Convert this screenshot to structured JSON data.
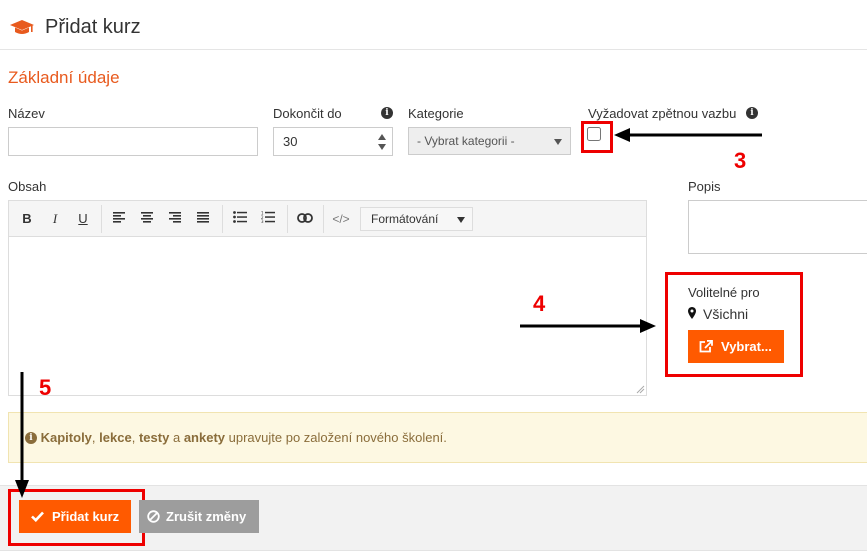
{
  "header": {
    "title": "Přidat kurz",
    "icon": "graduation-cap-icon"
  },
  "section_title": "Základní údaje",
  "fields": {
    "name_label": "Název",
    "name_value": "",
    "finish_label": "Dokončit do",
    "finish_value": "30",
    "category_label": "Kategorie",
    "category_value": "- Vybrat kategorii -",
    "feedback_label": "Vyžadovat zpětnou vazbu",
    "feedback_checked": false,
    "content_label": "Obsah",
    "description_label": "Popis",
    "description_value": ""
  },
  "editor_toolbar": {
    "bold": "B",
    "italic": "I",
    "underline": "U",
    "format_label": "Formátování"
  },
  "optional": {
    "label": "Volitelné pro",
    "value": "Všichni",
    "button": "Vybrat..."
  },
  "notice": {
    "w1": "Kapitoly",
    "s1": ",",
    "w2": "lekce",
    "s2": ",",
    "w3": "testy",
    "s3": "a",
    "w4": "ankety",
    "rest": "upravujte po založení nového školení."
  },
  "footer": {
    "add_button": "Přidat kurz",
    "cancel_button": "Zrušit změny"
  },
  "annotations": {
    "n3": "3",
    "n4": "4",
    "n5": "5"
  },
  "colors": {
    "accent": "#ff5a00",
    "section": "#e85a1e",
    "annotation": "#e00000"
  }
}
